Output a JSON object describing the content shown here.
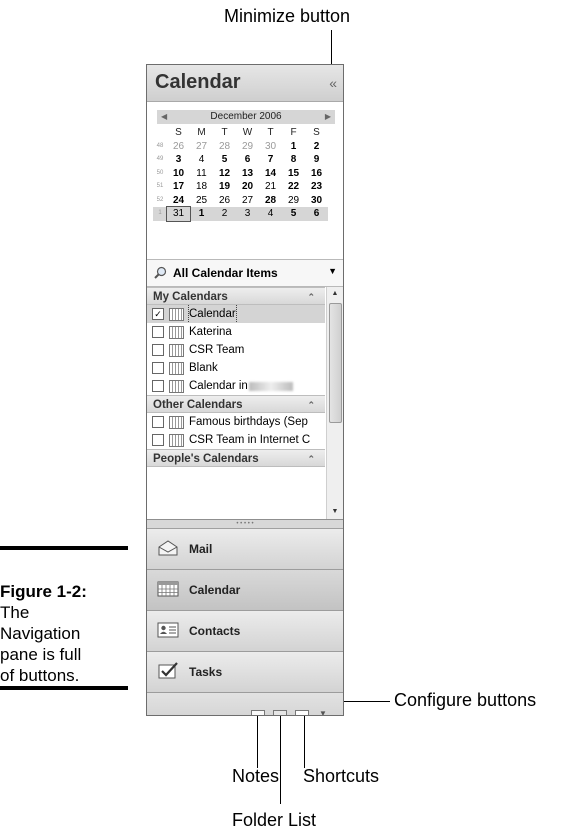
{
  "callouts": {
    "minimize": "Minimize  button",
    "configure": "Configure buttons",
    "notes": "Notes",
    "shortcuts": "Shortcuts",
    "folder_list": "Folder List"
  },
  "figure": {
    "label": "Figure 1-2:",
    "caption_lines": [
      "The",
      "Navigation",
      "pane is full",
      "of buttons."
    ]
  },
  "pane": {
    "title": "Calendar",
    "minimize_glyph": "«",
    "date_navigator": {
      "month": "December 2006",
      "day_headers": [
        "S",
        "M",
        "T",
        "W",
        "T",
        "F",
        "S"
      ],
      "weeks": [
        {
          "wk": "48",
          "days": [
            [
              "26",
              "grey"
            ],
            [
              "27",
              "grey"
            ],
            [
              "28",
              "grey"
            ],
            [
              "29",
              "grey"
            ],
            [
              "30",
              "grey"
            ],
            [
              "1",
              "bold"
            ],
            [
              "2",
              "bold"
            ]
          ]
        },
        {
          "wk": "49",
          "days": [
            [
              "3",
              "bold"
            ],
            [
              "4",
              ""
            ],
            [
              "5",
              "bold"
            ],
            [
              "6",
              "bold"
            ],
            [
              "7",
              "bold"
            ],
            [
              "8",
              "bold"
            ],
            [
              "9",
              "bold"
            ]
          ]
        },
        {
          "wk": "50",
          "days": [
            [
              "10",
              "bold"
            ],
            [
              "11",
              ""
            ],
            [
              "12",
              "bold"
            ],
            [
              "13",
              "bold"
            ],
            [
              "14",
              "bold"
            ],
            [
              "15",
              "bold"
            ],
            [
              "16",
              "bold"
            ]
          ]
        },
        {
          "wk": "51",
          "days": [
            [
              "17",
              "bold"
            ],
            [
              "18",
              ""
            ],
            [
              "19",
              "bold"
            ],
            [
              "20",
              "bold"
            ],
            [
              "21",
              ""
            ],
            [
              "22",
              "bold"
            ],
            [
              "23",
              "bold"
            ]
          ]
        },
        {
          "wk": "52",
          "days": [
            [
              "24",
              "bold"
            ],
            [
              "25",
              ""
            ],
            [
              "26",
              ""
            ],
            [
              "27",
              ""
            ],
            [
              "28",
              "bold"
            ],
            [
              "29",
              ""
            ],
            [
              "30",
              "bold"
            ]
          ]
        },
        {
          "wk": "1",
          "days": [
            [
              "31",
              "today"
            ],
            [
              "1",
              "bold"
            ],
            [
              "2",
              ""
            ],
            [
              "3",
              ""
            ],
            [
              "4",
              ""
            ],
            [
              "5",
              "bold"
            ],
            [
              "6",
              "bold"
            ]
          ]
        }
      ]
    },
    "filter": {
      "label": "All Calendar Items",
      "dropdown": "▼"
    },
    "groups": [
      {
        "title": "My Calendars",
        "items": [
          {
            "name": "Calendar",
            "checked": true,
            "selected": true
          },
          {
            "name": "Katerina",
            "checked": false
          },
          {
            "name": "CSR Team",
            "checked": false
          },
          {
            "name": "Blank",
            "checked": false
          },
          {
            "name": "Calendar in",
            "checked": false,
            "blurred": true
          }
        ]
      },
      {
        "title": "Other Calendars",
        "items": [
          {
            "name": "Famous birthdays (Sep",
            "checked": false
          },
          {
            "name": "CSR Team in Internet C",
            "checked": false
          }
        ]
      },
      {
        "title": "People's Calendars",
        "items": []
      }
    ],
    "buttons": [
      {
        "key": "mail",
        "label": "Mail"
      },
      {
        "key": "calendar",
        "label": "Calendar",
        "active": true
      },
      {
        "key": "contacts",
        "label": "Contacts"
      },
      {
        "key": "tasks",
        "label": "Tasks"
      }
    ]
  }
}
